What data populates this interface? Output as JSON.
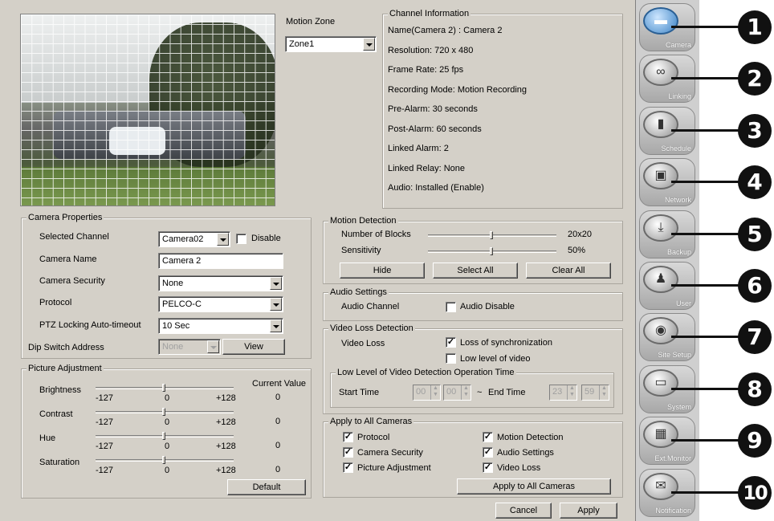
{
  "motion_zone": {
    "label": "Motion Zone",
    "value": "Zone1"
  },
  "channel_info": {
    "title": "Channel Information",
    "lines": [
      "Name(Camera  2) : Camera 2",
      "Resolution: 720 x 480",
      "Frame Rate:  25 fps",
      "Recording Mode: Motion Recording",
      "Pre-Alarm: 30 seconds",
      "Post-Alarm: 60 seconds",
      "Linked Alarm: 2",
      "Linked Relay: None",
      "Audio: Installed (Enable)"
    ]
  },
  "camera_properties": {
    "title": "Camera Properties",
    "selected_channel_label": "Selected Channel",
    "selected_channel_value": "Camera02",
    "disable_label": "Disable",
    "disable_checked": false,
    "camera_name_label": "Camera Name",
    "camera_name_value": "Camera 2",
    "camera_security_label": "Camera Security",
    "camera_security_value": "None",
    "protocol_label": "Protocol",
    "protocol_value": "PELCO-C",
    "ptz_label": "PTZ Locking Auto-timeout",
    "ptz_value": "10 Sec",
    "dip_label": "Dip Switch Address",
    "dip_value": "None",
    "view_label": "View"
  },
  "picture_adjustment": {
    "title": "Picture Adjustment",
    "current_value_label": "Current Value",
    "min_label": "-127",
    "mid_label": "0",
    "max_label": "+128",
    "rows": [
      {
        "label": "Brightness",
        "value": "0",
        "level": 0
      },
      {
        "label": "Contrast",
        "value": "0",
        "level": 0
      },
      {
        "label": "Hue",
        "value": "0",
        "level": 0
      },
      {
        "label": "Saturation",
        "value": "0",
        "level": 0
      }
    ],
    "default_label": "Default"
  },
  "motion_detection": {
    "title": "Motion Detection",
    "blocks_label": "Number of Blocks",
    "blocks_value": "20x20",
    "blocks_level": 0.5,
    "sensitivity_label": "Sensitivity",
    "sensitivity_value": "50%",
    "sensitivity_level": 0.5,
    "hide_label": "Hide",
    "select_all_label": "Select All",
    "clear_all_label": "Clear All"
  },
  "audio_settings": {
    "title": "Audio Settings",
    "channel_label": "Audio Channel",
    "disable_label": "Audio Disable",
    "disable_checked": false
  },
  "video_loss": {
    "title": "Video Loss Detection",
    "label": "Video Loss",
    "sync_label": "Loss of synchronization",
    "sync_checked": true,
    "low_label": "Low level of video",
    "low_checked": false,
    "op_time_title": "Low Level of Video Detection Operation Time",
    "start_label": "Start Time",
    "end_label": "End Time",
    "tilde": "~",
    "start_h": "00",
    "start_m": "00",
    "end_h": "23",
    "end_m": "59"
  },
  "apply_all": {
    "title": "Apply to All Cameras",
    "items": [
      {
        "label": "Protocol",
        "checked": true
      },
      {
        "label": "Camera Security",
        "checked": true
      },
      {
        "label": "Picture Adjustment",
        "checked": true
      },
      {
        "label": "Motion Detection",
        "checked": true
      },
      {
        "label": "Audio Settings",
        "checked": true
      },
      {
        "label": "Video Loss",
        "checked": true
      }
    ],
    "button_label": "Apply to All Cameras"
  },
  "footer": {
    "cancel_label": "Cancel",
    "apply_label": "Apply"
  },
  "sidebar": {
    "items": [
      {
        "label": "Camera",
        "icon": "camera-icon",
        "num": "1",
        "active": true
      },
      {
        "label": "Linking",
        "icon": "link-icon",
        "num": "2"
      },
      {
        "label": "Schedule",
        "icon": "calendar-icon",
        "num": "3"
      },
      {
        "label": "Network",
        "icon": "network-icon",
        "num": "4"
      },
      {
        "label": "Backup",
        "icon": "backup-icon",
        "num": "5"
      },
      {
        "label": "User",
        "icon": "user-icon",
        "num": "6"
      },
      {
        "label": "Site Setup",
        "icon": "site-setup-icon",
        "num": "7"
      },
      {
        "label": "System",
        "icon": "system-icon",
        "num": "8"
      },
      {
        "label": "Ext.Monitor",
        "icon": "monitor-icon",
        "num": "9"
      },
      {
        "label": "Notification",
        "icon": "mail-icon",
        "num": "10"
      }
    ]
  }
}
